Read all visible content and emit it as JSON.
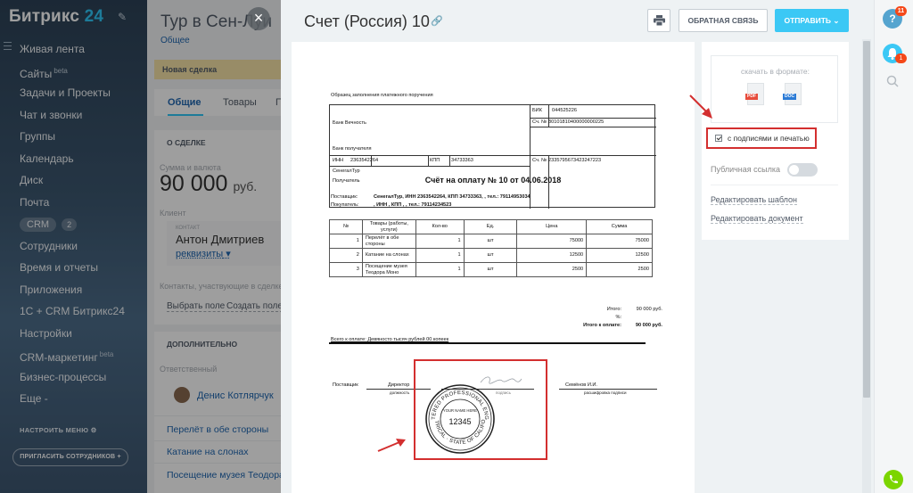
{
  "sidebar": {
    "logo_text": "Битрикс",
    "logo_num": "24",
    "items": [
      {
        "label": "Живая лента"
      },
      {
        "label": "Сайты",
        "sup": "beta"
      },
      {
        "label": "Задачи и Проекты"
      },
      {
        "label": "Чат и звонки"
      },
      {
        "label": "Группы"
      },
      {
        "label": "Календарь"
      },
      {
        "label": "Диск"
      },
      {
        "label": "Почта"
      },
      {
        "label": "CRM",
        "badge": "2"
      },
      {
        "label": "Сотрудники"
      },
      {
        "label": "Время и отчеты"
      },
      {
        "label": "Приложения"
      },
      {
        "label": "1С + CRM Битрикс24"
      },
      {
        "label": "Настройки"
      },
      {
        "label": "CRM-маркетинг",
        "sup": "beta"
      },
      {
        "label": "Бизнес-процессы"
      },
      {
        "label": "Еще -"
      }
    ],
    "configure_menu": "НАСТРОИТЬ МЕНЮ",
    "invite": "ПРИГЛАСИТЬ СОТРУДНИКОВ"
  },
  "deal": {
    "title": "Тур в Сен-Луи",
    "subtitle": "Общее",
    "stage": "Новая сделка",
    "tabs": [
      "Общие",
      "Товары",
      "П"
    ],
    "about_head": "О СДЕЛКЕ",
    "amount_label": "Сумма и валюта",
    "amount": "90 000",
    "currency": "руб.",
    "client_label": "Клиент",
    "contact_cap": "КОНТАКТ",
    "client_name": "Антон Дмитриев",
    "requisites": "реквизиты",
    "contacts_note": "Контакты, участвующие в сделке",
    "select_field": "Выбрать поле",
    "create_field": "Создать поле",
    "extra_head": "ДОПОЛНИТЕЛЬНО",
    "responsible_label": "Ответственный",
    "responsible": "Денис Котлярчук",
    "products": [
      "Перелёт в обе стороны",
      "Катание на слонах",
      "Посещение музея Теодора Моно"
    ]
  },
  "slider": {
    "title": "Счет (Россия) 10",
    "feedback": "ОБРАТНАЯ СВЯЗЬ",
    "send": "ОТПРАВИТЬ"
  },
  "invoice": {
    "sample_note": "Образец заполнения платежного поручения",
    "bank_name": "Банк Вечность",
    "bank_recipient": "Банк получателя",
    "bik_label": "БИК",
    "bik": "044525226",
    "acc_label": "Сч. №",
    "corr_account": "30101810400000000225",
    "inn_label": "ИНН",
    "inn": "2363542264",
    "kpp_label": "КПП",
    "kpp": "34733363",
    "account": "2335795673423247223",
    "company": "СенегалТур",
    "recipient": "Получатель",
    "title": "Счёт на оплату № 10 от 04.06.2018",
    "supplier_label": "Поставщик:",
    "supplier": "СенегалТур, ИНН 2363542264, КПП 34733363, , тел.: 79114953034",
    "buyer_label": "Покупатель:",
    "buyer": ", ИНН , КПП , , тел.: 79114234523",
    "columns": [
      "№",
      "Товары (работы, услуги)",
      "Кол-во",
      "Ед.",
      "Цена",
      "Сумма"
    ],
    "rows": [
      {
        "n": "1",
        "name": "Перелёт в обе стороны",
        "qty": "1",
        "unit": "шт",
        "price": "75000",
        "sum": "75000"
      },
      {
        "n": "2",
        "name": "Катание на слонах",
        "qty": "1",
        "unit": "шт",
        "price": "12500",
        "sum": "12500"
      },
      {
        "n": "3",
        "name": "Посещение музея Теодора Моно",
        "qty": "1",
        "unit": "шт",
        "price": "2500",
        "sum": "2500"
      }
    ],
    "total_label": "Итого:",
    "total": "90 000 руб.",
    "vat_label": "%:",
    "total_vat_label": "Итого к оплате:",
    "total_vat": "90 000 руб.",
    "in_words": "Всего к оплате: Девяносто тысяч рублей 00 копеек",
    "sign_supplier": "Поставщик",
    "director": "Директор",
    "position": "должность",
    "signature_cap": "подпись",
    "signer_name": "Семёнов И.И.",
    "decoding_cap": "расшифровка подписи",
    "stamp_top": "REGISTERED PROFESSIONAL ENGINEER",
    "stamp_name": "YOUR NAME HERE",
    "stamp_number": "12345",
    "stamp_bottom": "ELECTRICAL · STATE OF CALIFORNIA"
  },
  "right_panel": {
    "download_caption": "скачать в формате:",
    "pdf": "PDF",
    "doc": "DOC",
    "sign_label": "с подписями и печатью",
    "public_link": "Публичная ссылка",
    "edit_template": "Редактировать шаблон",
    "edit_document": "Редактировать документ"
  },
  "rightbar": {
    "help_badge": "11",
    "bell_badge": "1"
  }
}
